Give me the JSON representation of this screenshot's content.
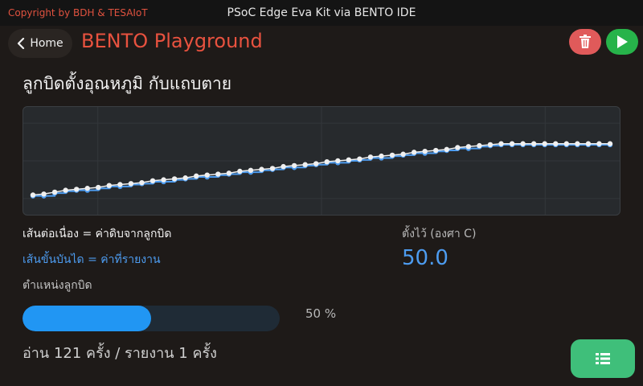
{
  "window": {
    "copyright": "Copyright by BDH & TESAIoT",
    "title": "PSoC Edge Eva Kit via BENTO IDE"
  },
  "header": {
    "home_label": "Home",
    "app_title": "BENTO Playground",
    "delete_icon": "trash-icon",
    "run_icon": "play-icon"
  },
  "main": {
    "heading": "ลูกบิดตั้งอุณหภูมิ กับแถบตาย",
    "legend_raw": "เส้นต่อเนื่อง = ค่าดิบจากลูกบิด",
    "legend_step": "เส้นขั้นบันได = ค่าที่รายงาน",
    "setpoint_label": "ตั้งไว้ (องศา C)",
    "setpoint_value": "50.0",
    "knob_label": "ตำแหน่งลูกบิด",
    "knob_percent": 50,
    "knob_percent_text": "50 %",
    "read_stats": "อ่าน 121 ครั้ง / รายงาน 1 ครั้ง",
    "list_icon": "list-icon"
  },
  "colors": {
    "raw_line": "#f0f0f0",
    "step_line": "#4d9cf0",
    "accent_red": "#e8523f",
    "progress": "#2196f3",
    "run": "#27b34a",
    "delete": "#e05a5a",
    "list_button": "#3fbf7a"
  },
  "chart_data": {
    "type": "line",
    "title": "",
    "xlabel": "",
    "ylabel": "",
    "grid": true,
    "legend": "none",
    "ylim": [
      0,
      100
    ],
    "x": [
      1,
      2,
      3,
      4,
      5,
      6,
      7,
      8,
      9,
      10,
      11,
      12,
      13,
      14,
      15,
      16,
      17,
      18,
      19,
      20,
      21,
      22,
      23,
      24,
      25,
      26,
      27,
      28,
      29,
      30,
      31,
      32,
      33,
      34,
      35,
      36,
      37,
      38,
      39,
      40,
      41,
      42,
      43,
      44,
      45,
      46,
      47,
      48,
      49,
      50,
      51,
      52,
      53,
      54
    ],
    "series": [
      {
        "role": "raw",
        "values": [
          14,
          15,
          17,
          19,
          20,
          21,
          22,
          24,
          25,
          26,
          27,
          29,
          30,
          31,
          32,
          34,
          35,
          36,
          37,
          39,
          40,
          41,
          42,
          44,
          45,
          46,
          47,
          49,
          50,
          51,
          52,
          54,
          55,
          56,
          57,
          59,
          60,
          61,
          62,
          64,
          65,
          66,
          67,
          68,
          68,
          68,
          68,
          68,
          68,
          68,
          68,
          68,
          68,
          68
        ]
      },
      {
        "role": "reported",
        "values": [
          13,
          13,
          16,
          18,
          19,
          19,
          21,
          23,
          23,
          25,
          26,
          28,
          28,
          30,
          31,
          33,
          33,
          35,
          36,
          38,
          38,
          40,
          41,
          43,
          43,
          45,
          46,
          48,
          48,
          50,
          51,
          53,
          53,
          55,
          56,
          58,
          58,
          60,
          61,
          63,
          63,
          65,
          66,
          67,
          67,
          67,
          67,
          67,
          67,
          67,
          67,
          67,
          67,
          67
        ]
      }
    ]
  }
}
